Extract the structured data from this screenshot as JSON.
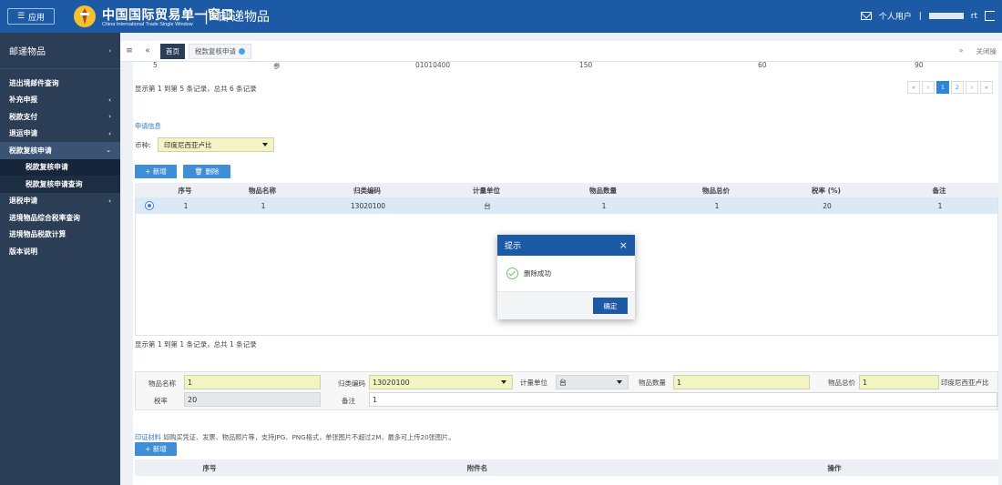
{
  "header": {
    "app_button": "应用",
    "brand_title": "中国国际贸易单一窗口",
    "brand_subtitle": "China International Trade Single Window",
    "module": "邮递物品",
    "user": "个人用户",
    "user_suffix": "rt"
  },
  "sidebar": {
    "title": "邮递物品",
    "items": [
      {
        "label": "进出境邮件查询",
        "chevron": ""
      },
      {
        "label": "补充申报",
        "chevron": "‹"
      },
      {
        "label": "税款支付",
        "chevron": "‹"
      },
      {
        "label": "退运申请",
        "chevron": "‹"
      },
      {
        "label": "税款复核申请",
        "chevron": "⌄"
      },
      {
        "label": "税款复核申请",
        "chevron": ""
      },
      {
        "label": "税款复核申请查询",
        "chevron": ""
      },
      {
        "label": "退税申请",
        "chevron": "‹"
      },
      {
        "label": "进境物品综合税率查询",
        "chevron": ""
      },
      {
        "label": "进境物品税款计算",
        "chevron": ""
      },
      {
        "label": "版本说明",
        "chevron": ""
      }
    ]
  },
  "tabs": {
    "home": "首页",
    "active": "税款复核申请",
    "close_all": "关闭操"
  },
  "top_table_row": {
    "col1": "5",
    "col2": "参",
    "col3": "01010400",
    "col4": "150",
    "col5": "60",
    "col6": "90"
  },
  "top_pager": {
    "info": "显示第 1 到第 5 条记录，总共 6 条记录",
    "first": "«",
    "prev": "‹",
    "page1": "1",
    "page2": "2",
    "next": "›",
    "last": "»"
  },
  "apply": {
    "section_title": "申请信息",
    "currency_label": "币种:",
    "currency_value": "印度尼西亚卢比",
    "add_button": "+ 新增",
    "delete_button": "🗑 删除"
  },
  "items_grid": {
    "headers": [
      "序号",
      "物品名称",
      "归类编码",
      "计量单位",
      "物品数量",
      "物品总价",
      "税率 (%)",
      "备注"
    ],
    "rows": [
      [
        "1",
        "1",
        "13020100",
        "台",
        "1",
        "1",
        "20",
        "1"
      ]
    ],
    "pager_info": "显示第 1 到第 1 条记录，总共 1 条记录"
  },
  "form": {
    "name_label": "物品名称",
    "name_value": "1",
    "code_label": "归类编码",
    "code_value": "13020100",
    "unit_label": "计量单位",
    "unit_value": "台",
    "qty_label": "物品数量",
    "qty_value": "1",
    "total_label": "物品总价",
    "total_value": "1",
    "currency_suffix": "印度尼西亚卢比",
    "rate_label": "税率",
    "rate_value": "20",
    "remark_label": "备注",
    "remark_value": "1"
  },
  "attachments": {
    "title": "印证材料",
    "hint": "如购买凭证、发票、物品照片等，支持JPG、PNG格式，单张图片不超过2M，最多可上传20张图片。",
    "add_button": "+ 新增",
    "headers": [
      "序号",
      "附件名",
      "操作"
    ]
  },
  "modal": {
    "title": "提示",
    "close": "×",
    "message": "删除成功",
    "ok": "确定"
  },
  "colors": {
    "header_blue": "#1c5aa6",
    "sidebar_bg": "#2b3e55",
    "input_yellow": "#f3f4c3",
    "success_green": "#6ec36a"
  }
}
